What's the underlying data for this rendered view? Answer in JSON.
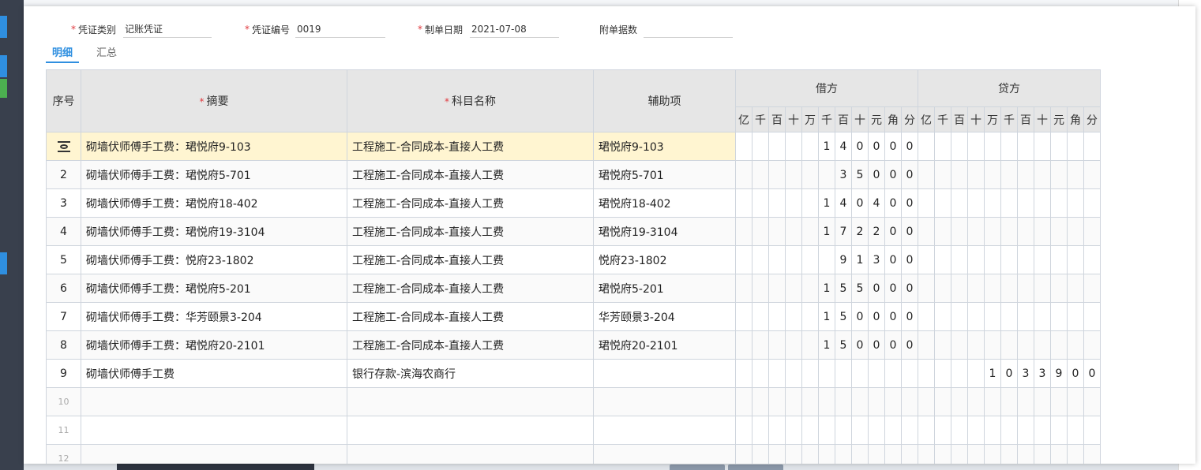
{
  "voucher": {
    "type_label": "凭证类别",
    "type_value": "记账凭证",
    "number_label": "凭证编号",
    "number_value": "0019",
    "date_label": "制单日期",
    "date_value": "2021-07-08",
    "attach_label": "附单据数",
    "attach_value": ""
  },
  "tabs": [
    {
      "label": "明细",
      "active": true
    },
    {
      "label": "汇总",
      "active": false
    }
  ],
  "columns": {
    "seq": "序号",
    "summary": "摘要",
    "account": "科目名称",
    "aux": "辅助项",
    "debit": "借方",
    "credit": "贷方",
    "units": [
      "亿",
      "千",
      "百",
      "十",
      "万",
      "千",
      "百",
      "十",
      "元",
      "角",
      "分"
    ]
  },
  "rows": [
    {
      "seq": "",
      "summary": "砌墙伏师傅手工费：珺悦府9-103",
      "account": "工程施工-合同成本-直接人工费",
      "aux": "珺悦府9-103",
      "debit": "140000",
      "credit": ""
    },
    {
      "seq": "2",
      "summary": "砌墙伏师傅手工费：珺悦府5-701",
      "account": "工程施工-合同成本-直接人工费",
      "aux": "珺悦府5-701",
      "debit": "35000",
      "credit": ""
    },
    {
      "seq": "3",
      "summary": "砌墙伏师傅手工费：珺悦府18-402",
      "account": "工程施工-合同成本-直接人工费",
      "aux": "珺悦府18-402",
      "debit": "140400",
      "credit": ""
    },
    {
      "seq": "4",
      "summary": "砌墙伏师傅手工费：珺悦府19-3104",
      "account": "工程施工-合同成本-直接人工费",
      "aux": "珺悦府19-3104",
      "debit": "172200",
      "credit": ""
    },
    {
      "seq": "5",
      "summary": "砌墙伏师傅手工费：悦府23-1802",
      "account": "工程施工-合同成本-直接人工费",
      "aux": "悦府23-1802",
      "debit": "91300",
      "credit": ""
    },
    {
      "seq": "6",
      "summary": "砌墙伏师傅手工费：珺悦府5-201",
      "account": "工程施工-合同成本-直接人工费",
      "aux": "珺悦府5-201",
      "debit": "155000",
      "credit": ""
    },
    {
      "seq": "7",
      "summary": "砌墙伏师傅手工费：华芳颐景3-204",
      "account": "工程施工-合同成本-直接人工费",
      "aux": "华芳颐景3-204",
      "debit": "150000",
      "credit": ""
    },
    {
      "seq": "8",
      "summary": "砌墙伏师傅手工费：珺悦府20-2101",
      "account": "工程施工-合同成本-直接人工费",
      "aux": "珺悦府20-2101",
      "debit": "150000",
      "credit": ""
    },
    {
      "seq": "9",
      "summary": "砌墙伏师傅手工费",
      "account": "银行存款-滨海农商行",
      "aux": "",
      "debit": "",
      "credit": "1033900"
    },
    {
      "seq": "10",
      "summary": "",
      "account": "",
      "aux": "",
      "debit": "",
      "credit": ""
    },
    {
      "seq": "11",
      "summary": "",
      "account": "",
      "aux": "",
      "debit": "",
      "credit": ""
    },
    {
      "seq": "12",
      "summary": "",
      "account": "",
      "aux": "",
      "debit": "",
      "credit": ""
    }
  ],
  "colors": {
    "accent": "#2f8fe0",
    "required": "#e0393e",
    "selected_row": "#fff5d1",
    "header_bg": "#e6e6e6"
  }
}
